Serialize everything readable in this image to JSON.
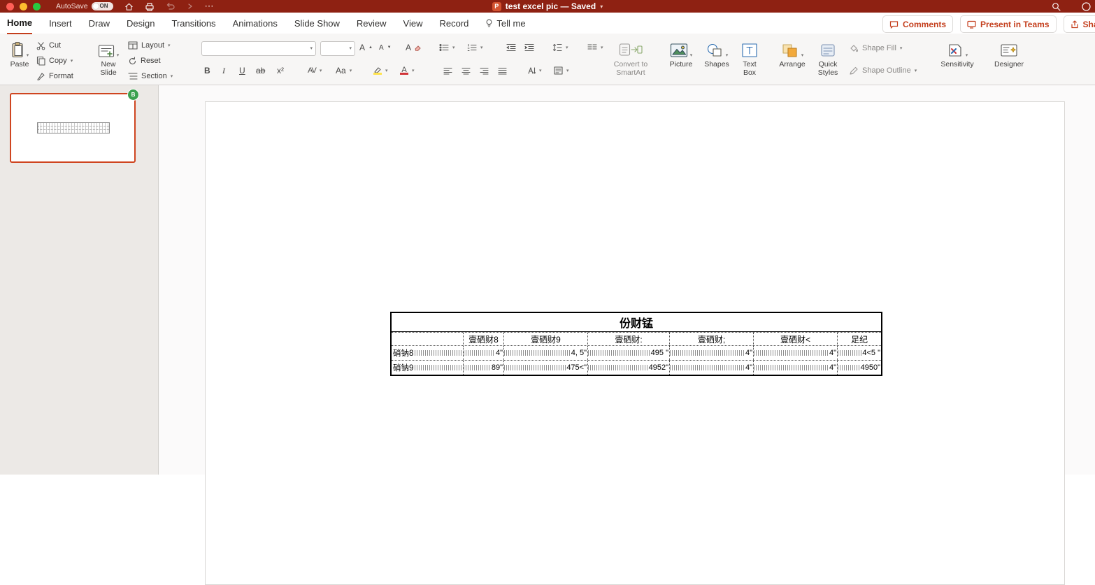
{
  "titlebar": {
    "autosave_label": "AutoSave",
    "autosave_state": "ON",
    "doc_title": "test excel pic — Saved"
  },
  "tabs": {
    "items": [
      "Home",
      "Insert",
      "Draw",
      "Design",
      "Transitions",
      "Animations",
      "Slide Show",
      "Review",
      "View",
      "Record",
      "Tell me"
    ]
  },
  "tab_actions": {
    "comments_label": "Comments",
    "present_label": "Present in Teams",
    "share_label": "Share"
  },
  "ribbon": {
    "paste_label": "Paste",
    "cut_label": "Cut",
    "copy_label": "Copy",
    "format_label": "Format",
    "new_slide_label": "New Slide",
    "layout_label": "Layout",
    "reset_label": "Reset",
    "section_label": "Section",
    "bold_glyph": "B",
    "italic_glyph": "I",
    "underline_glyph": "U",
    "strike_glyph": "ab",
    "script_glyph": "x²",
    "spacing_glyph": "AV",
    "case_glyph": "Aa",
    "fontcolor_glyph": "A",
    "convert_smartart_label": "Convert to SmartArt",
    "picture_label": "Picture",
    "shapes_label": "Shapes",
    "text_box_label": "Text Box",
    "arrange_label": "Arrange",
    "quick_styles_label": "Quick Styles",
    "shape_fill_label": "Shape Fill",
    "shape_outline_label": "Shape Outline",
    "sensitivity_label": "Sensitivity",
    "designer_label": "Designer"
  },
  "thumbnail_panel": {
    "presence_badge": "B"
  },
  "slide_table": {
    "title": "份财锰",
    "headers": [
      "",
      "壹硒财8",
      "壹硒财9",
      "壹硒财:",
      "壹硒财;",
      "壹硒财<",
      "足纪"
    ],
    "rows": [
      {
        "label": "硝钠8",
        "values": [
          "4\"",
          "4, 5\"",
          "495 \"",
          "4\"",
          "4\"",
          "4<5 \""
        ]
      },
      {
        "label": "硝钠9",
        "values": [
          "89\"",
          "475<\"",
          "4952\"",
          "4\"",
          "4\"",
          "4950\""
        ]
      }
    ]
  },
  "colors": {
    "titlebar": "#8e2112",
    "accent": "#c43e1c",
    "selection_border": "#cf4520"
  }
}
